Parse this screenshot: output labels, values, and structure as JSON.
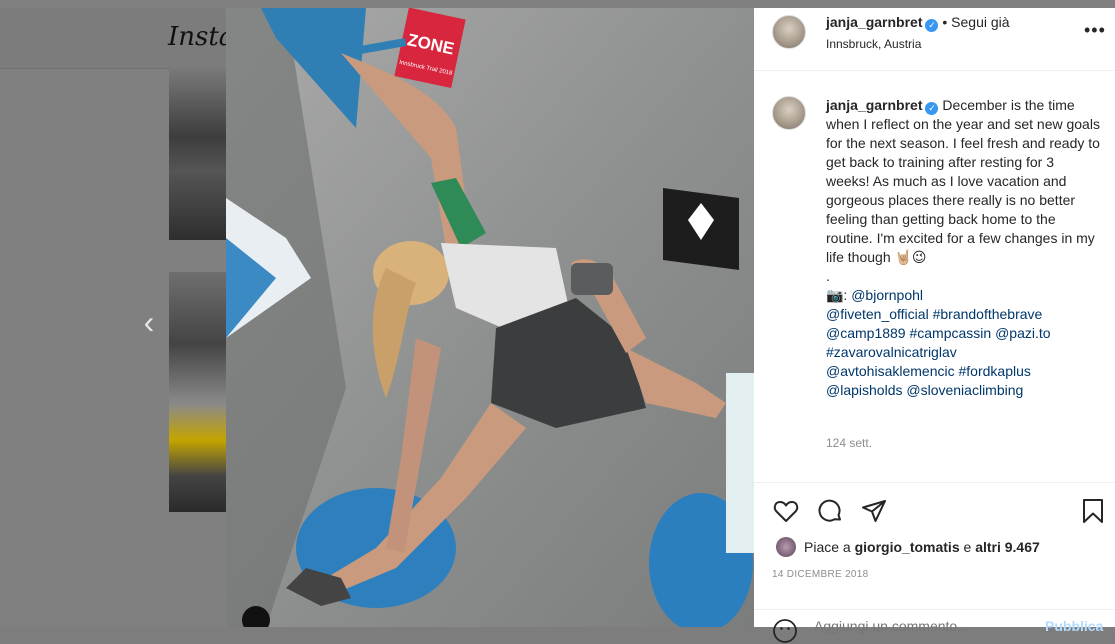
{
  "background": {
    "logo": "Insta"
  },
  "nav": {
    "prev_arrow": "‹"
  },
  "photo": {
    "zone_label": "ZONE",
    "zone_sub": "Innsbruck Trail 2018"
  },
  "post": {
    "username": "janja_garnbret",
    "verified": "✓",
    "follow_status": "• Segui già",
    "location": "Innsbruck, Austria",
    "more": "•••",
    "caption_username": "janja_garnbret",
    "caption_text": "December is the time when I reflect on the year and set new goals for the next season. I feel fresh and ready to get back to training after resting for 3 weeks! As much as I love vacation and gorgeous places there really is no better feeling than getting back home to the routine. I'm excited for a few changes in my life though 🤘🏼😉",
    "dot": ".",
    "camera": "📷:",
    "tags": [
      "@bjornpohl",
      "@fiveten_official",
      "#brandofthebrave",
      "@camp1889",
      "#campcassin",
      "@pazi.to",
      "#zavarovalnicatriglav",
      "@avtohisaklemencic",
      "#fordkaplus",
      "@lapisholds",
      "@sloveniaclimbing"
    ],
    "time_ago": "124 sett.",
    "likes_prefix": "Piace a ",
    "likes_user": "giorgio_tomatis",
    "likes_mid": " e ",
    "likes_count": "altri 9.467",
    "date": "14 DICEMBRE 2018",
    "comment_placeholder": "Aggiungi un commento...",
    "publish_label": "Pubblica"
  },
  "colors": {
    "link": "#00376b",
    "verified": "#3897f0",
    "muted": "#8e8e8e"
  }
}
